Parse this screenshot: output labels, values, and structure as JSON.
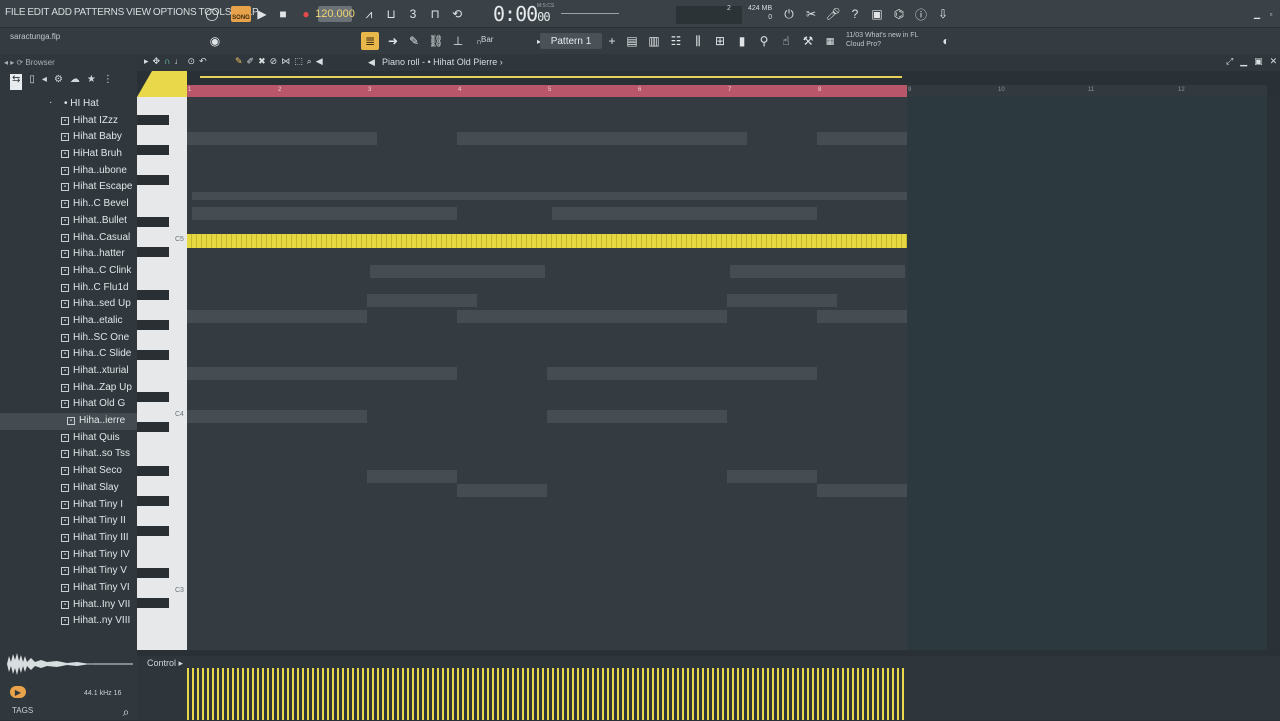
{
  "menu": [
    "FILE",
    "EDIT",
    "ADD",
    "PATTERNS",
    "VIEW",
    "OPTIONS",
    "TOOLS",
    "HELP"
  ],
  "transport": {
    "mode_label": "SONG",
    "tempo": "120.000",
    "time_main": "0:00",
    "time_small": "00",
    "time_caption": "M:S:CS"
  },
  "memory": {
    "line1": "424 MB",
    "line2": "0",
    "bar": "2"
  },
  "project": {
    "file": "saractunga.flp"
  },
  "snap": "Bar",
  "pattern": "Pattern 1",
  "news": {
    "date": "11/03",
    "line1": "What's new in FL",
    "line2": "Cloud Pro?"
  },
  "browser": {
    "title": "Browser",
    "folder": "HI Hat",
    "items": [
      "Hihat IZzz",
      "Hihat Baby",
      "HiHat Bruh",
      "Hiha..ubone",
      "Hihat Escape",
      "Hih..C Bevel",
      "Hihat..Bullet",
      "Hiha..Casual",
      "Hiha..hatter",
      "Hiha..C Clink",
      "Hih..C Flu1d",
      "Hiha..sed Up",
      "Hiha..etalic",
      "Hih..SC One",
      "Hiha..C Slide",
      "Hihat..xturial",
      "Hiha..Zap Up",
      "Hihat Old G",
      "Hiha..ierre",
      "Hihat Quis",
      "Hihat..so Tss",
      "Hihat Seco",
      "Hihat Slay",
      "Hihat Tiny I",
      "Hihat Tiny II",
      "Hihat Tiny III",
      "Hihat Tiny IV",
      "Hihat Tiny V",
      "Hihat Tiny VI",
      "Hihat..Iny VII",
      "Hihat..ny VIII"
    ],
    "selected_index": 18,
    "sample_rate": "44.1 kHz 16",
    "tags_label": "TAGS"
  },
  "piano_roll": {
    "title": "Piano roll",
    "separator": "›",
    "instrument": "• Hihat Old Pierre",
    "ruler_numbers": [
      "1",
      "2",
      "3",
      "4",
      "5",
      "6",
      "7",
      "8",
      "9",
      "10",
      "11",
      "12"
    ],
    "key_labels": [
      "C5",
      "C4",
      "C3"
    ],
    "control_label": "Control"
  },
  "colors": {
    "accent": "#e5d840",
    "ruler": "#b9566a",
    "song": "#e8a34a"
  }
}
